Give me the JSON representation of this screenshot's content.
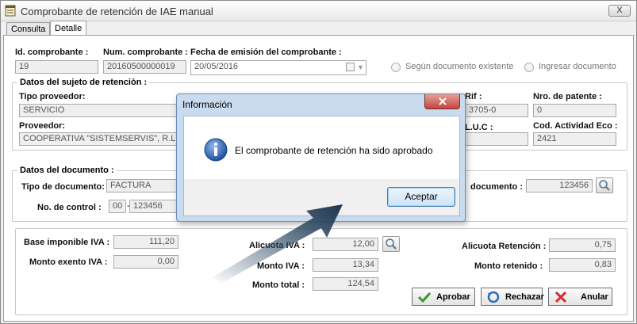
{
  "window": {
    "title": "Comprobante de retención de IAE manual",
    "close_label": "X"
  },
  "tabs": [
    {
      "label": "Consulta"
    },
    {
      "label": "Detalle"
    }
  ],
  "header": {
    "id_label": "Id. comprobante :",
    "id_value": "19",
    "num_label": "Num. comprobante :",
    "num_value": "20160500000019",
    "fecha_label": "Fecha de emisión del comprobante :",
    "fecha_value": "20/05/2016",
    "radio_existente": "Según documento existente",
    "radio_ingresar": "Ingresar documento"
  },
  "sujeto": {
    "title": "Datos del sujeto de retenciòn :",
    "tipo_label": "Tipo proveedor:",
    "tipo_value": "SERVICIO",
    "proveedor_label": "Proveedor:",
    "proveedor_value": "COOPERATIVA \"SISTEMSERVIS\", R.L.",
    "rif_label": "Rif :",
    "rif_value": "3705-0",
    "patente_label": "Nro. de patente :",
    "patente_value": "0",
    "luc_label": "L.U.C :",
    "cod_label": "Cod. Actividad Eco :",
    "cod_value": "2421"
  },
  "documento": {
    "title": "Datos del documento :",
    "tipo_label": "Tipo de documento:",
    "tipo_value": "FACTURA",
    "control_label": "No. de control :",
    "control_prefix": "00",
    "control_dash": "-",
    "control_value": "123456",
    "num_doc_label": "documento :",
    "num_doc_value": "123456"
  },
  "montos": {
    "base_label": "Base imponible IVA :",
    "base_value": "111,20",
    "exento_label": "Monto exento IVA :",
    "exento_value": "0,00",
    "alicuota_label": "Alicuota IVA :",
    "alicuota_value": "12,00",
    "monto_iva_label": "Monto IVA :",
    "monto_iva_value": "13,34",
    "total_label": "Monto total :",
    "total_value": "124,54",
    "alic_ret_label": "Alicuota Retención :",
    "alic_ret_value": "0,75",
    "retenido_label": "Monto retenido :",
    "retenido_value": "0,83"
  },
  "actions": {
    "aprobar": "Aprobar",
    "rechazar": "Rechazar",
    "anular": "Anular"
  },
  "dialog": {
    "title": "Información",
    "message": "El comprobante de retención ha sido aprobado",
    "ok_label": "Aceptar"
  }
}
